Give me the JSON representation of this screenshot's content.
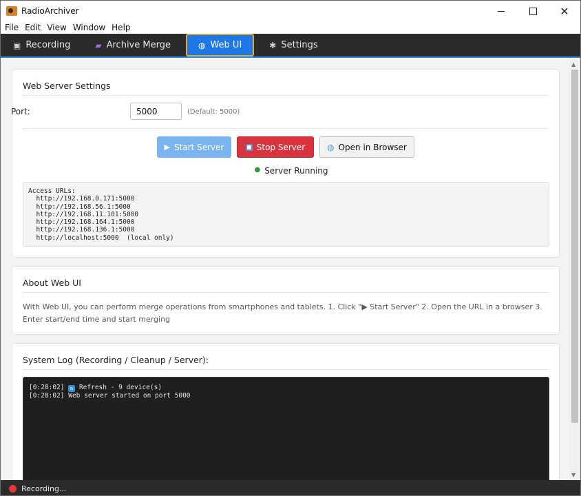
{
  "window": {
    "title": "RadioArchiver",
    "close_glyph": "✕"
  },
  "menu": [
    "File",
    "Edit",
    "View",
    "Window",
    "Help"
  ],
  "tabs": [
    {
      "label": "Recording",
      "icon": "camera-icon",
      "glyph": "▣"
    },
    {
      "label": "Archive Merge",
      "icon": "archive-icon",
      "glyph": "▰"
    },
    {
      "label": "Web UI",
      "icon": "globe-icon",
      "glyph": "◍",
      "active": true
    },
    {
      "label": "Settings",
      "icon": "gear-icon",
      "glyph": "✱"
    }
  ],
  "web_server": {
    "title": "Web Server Settings",
    "port_label": "Port:",
    "port_value": "5000",
    "port_hint": "(Default: 5000)",
    "start_label": "Start Server",
    "start_glyph": "▶",
    "stop_label": "Stop Server",
    "open_label": "Open in Browser",
    "open_glyph": "◍",
    "status_glyph": "●",
    "status_text": "Server Running",
    "access_urls": "Access URLs:\n  http://192.168.0.171:5000\n  http://192.168.56.1:5000\n  http://192.168.11.101:5000\n  http://192.168.164.1:5000\n  http://192.168.136.1:5000\n  http://localhost:5000  (local only)"
  },
  "about": {
    "title": "About Web UI",
    "text": "With Web UI, you can perform merge operations from smartphones and tablets. 1. Click \"▶ Start Server\" 2. Open the URL in a browser 3. Enter start/end time and start merging"
  },
  "system_log": {
    "title": "System Log (Recording / Cleanup / Server):",
    "lines": [
      {
        "time": "[0:28:02]",
        "icon": "refresh-icon",
        "glyph": "↻",
        "text": "Refresh - 9 device(s)"
      },
      {
        "time": "[0:28:02]",
        "text": "Web server started on port 5000"
      }
    ]
  },
  "statusbar": {
    "text": "Recording...",
    "color": "#e53935"
  },
  "colors": {
    "accent": "#1e78e6",
    "danger": "#d9343e",
    "success": "#2e9b3a"
  }
}
